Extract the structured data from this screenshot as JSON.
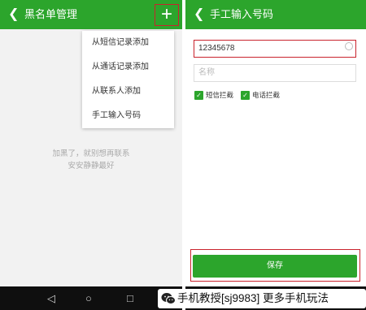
{
  "left_screen": {
    "title": "黑名单管理",
    "back_icon": "chevron-left-icon",
    "add_icon": "plus-icon",
    "add_glyph": "+",
    "menu": [
      "从短信记录添加",
      "从通话记录添加",
      "从联系人添加",
      "手工输入号码"
    ],
    "empty_line1": "加黑了，就别想再联系",
    "empty_line2": "安安静静最好"
  },
  "right_screen": {
    "title": "手工输入号码",
    "back_icon": "chevron-left-icon",
    "phone_value": "12345678",
    "name_placeholder": "名称",
    "checkbox_sms": "短信拦截",
    "checkbox_call": "电话拦截",
    "save_label": "保存"
  },
  "watermark": {
    "text": "手机教授[sj9983] 更多手机玩法",
    "icon": "wechat-icon"
  },
  "colors": {
    "accent_green": "#2ca52c",
    "highlight_red": "#c9232d",
    "nav_bar": "#0f0f0f"
  }
}
